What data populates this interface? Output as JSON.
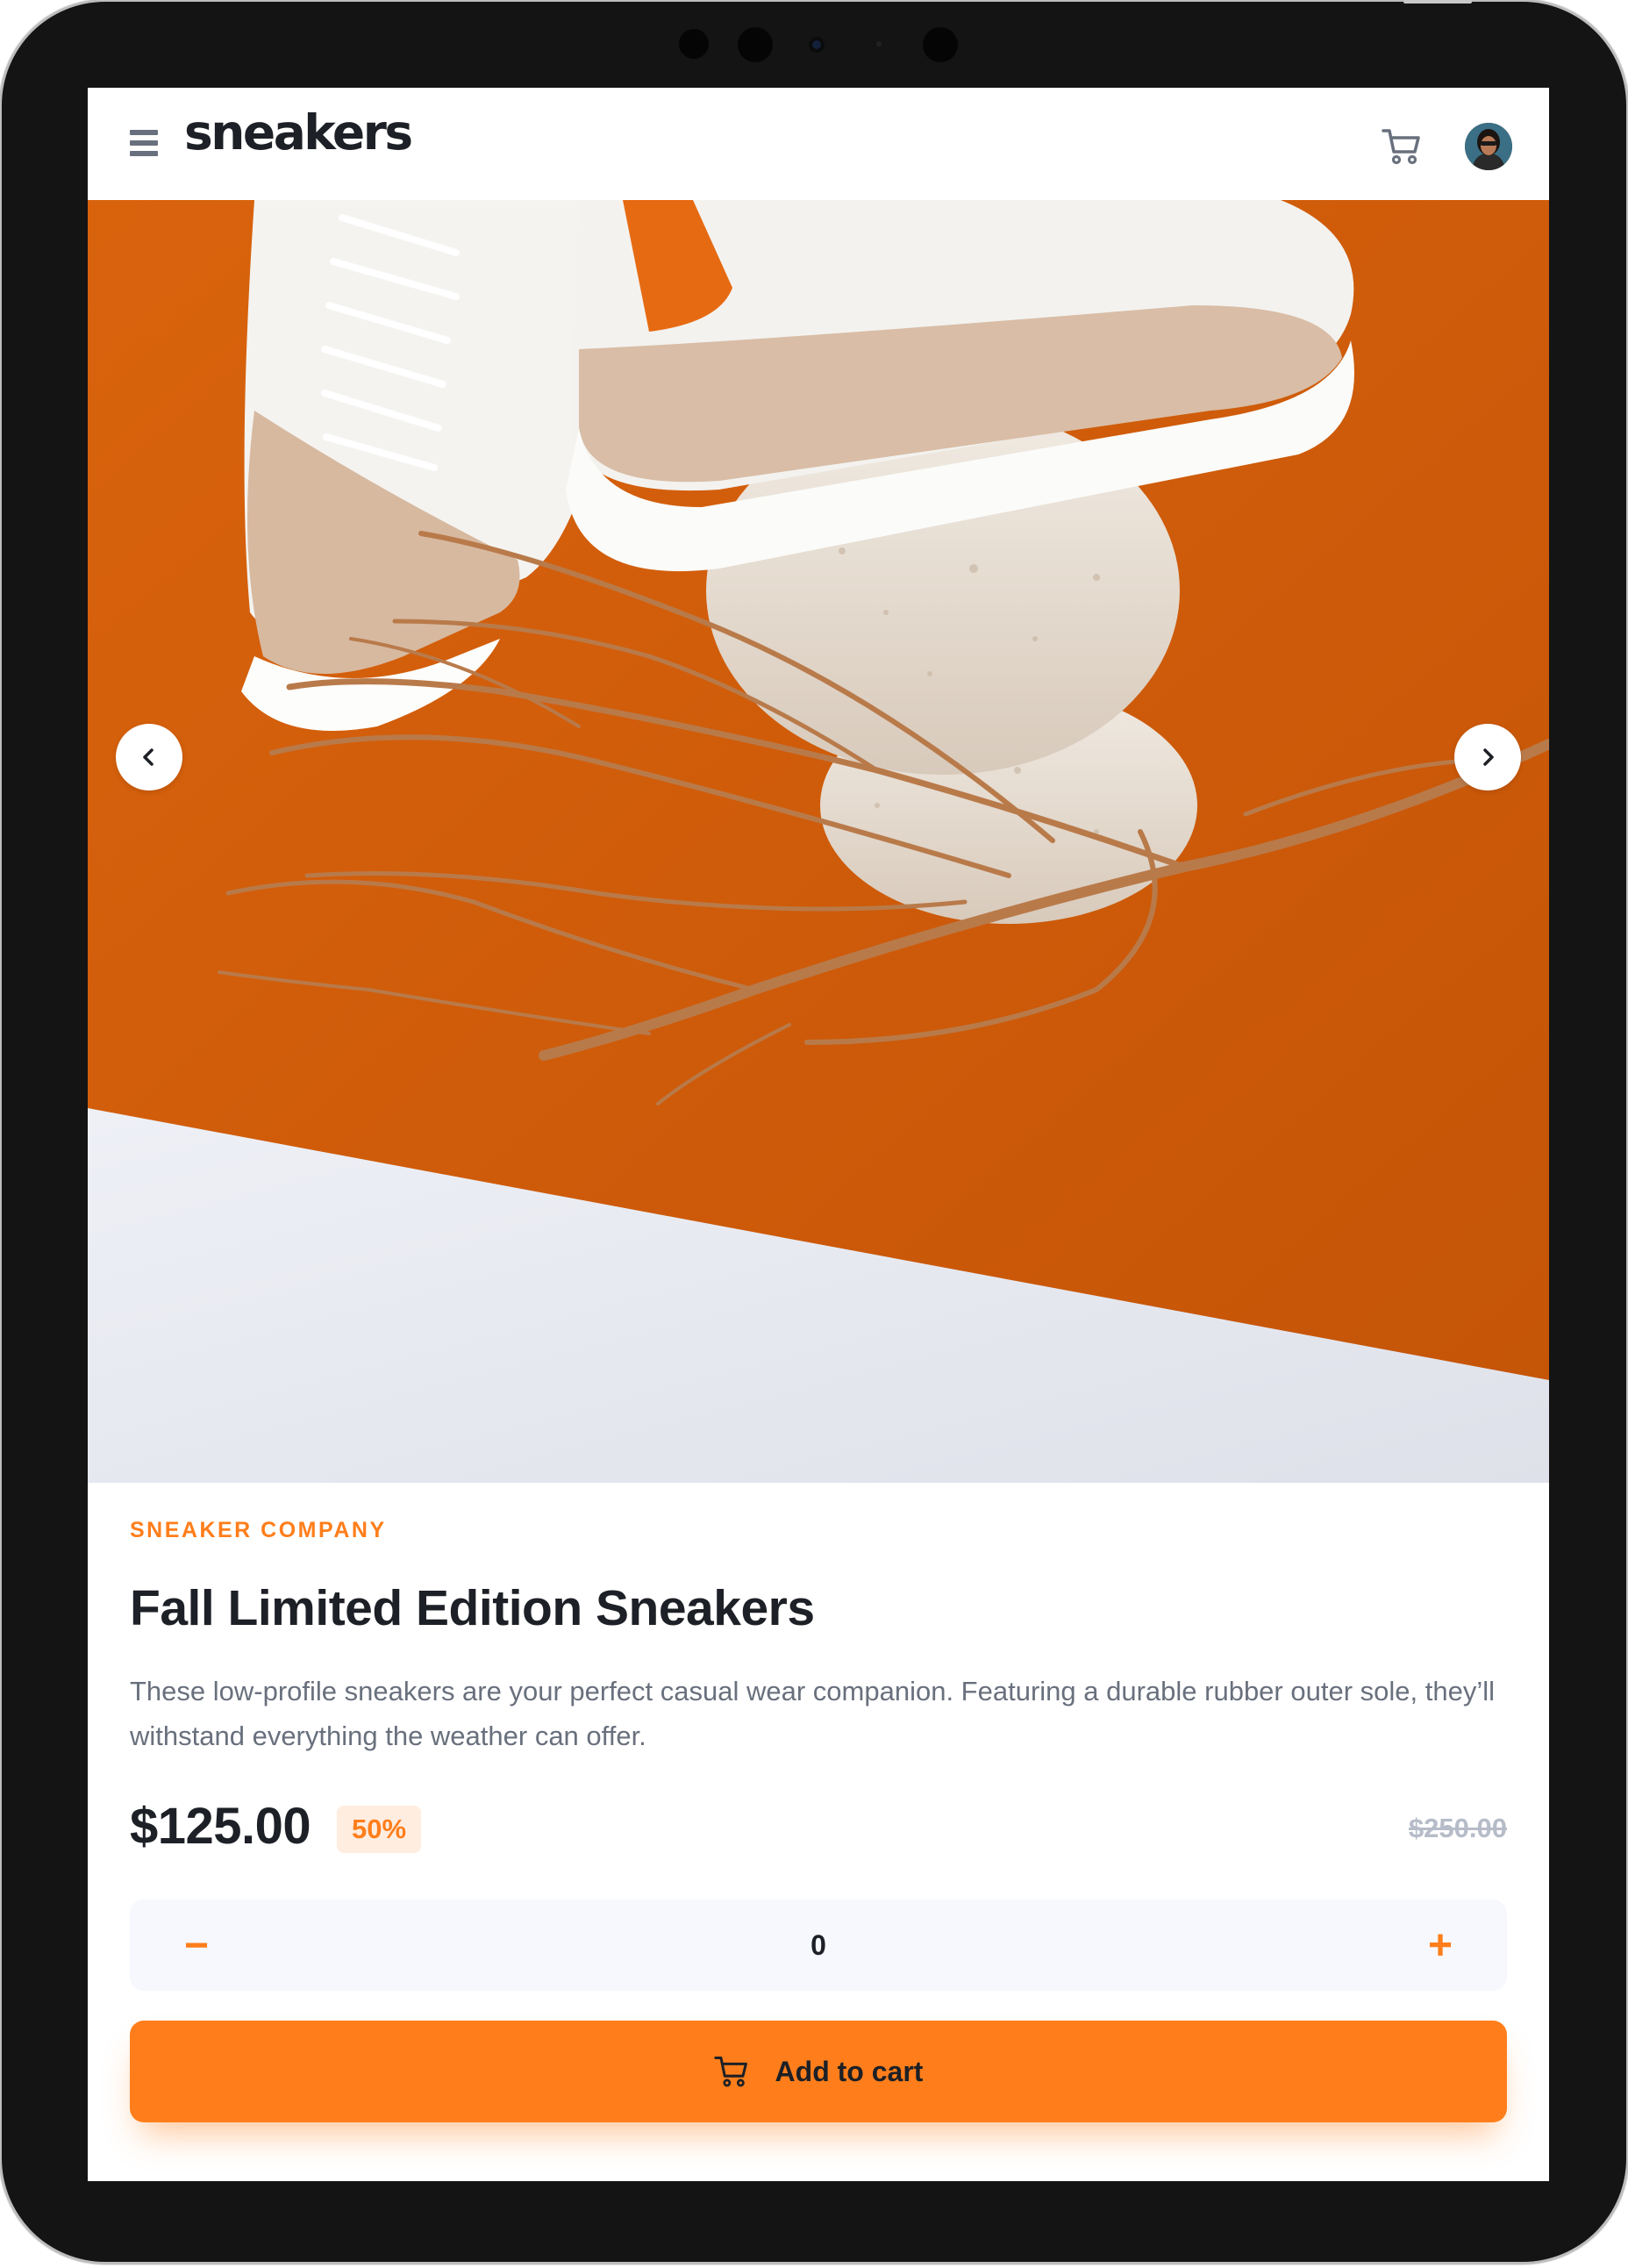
{
  "header": {
    "logo": "sneakers",
    "menu_icon": "hamburger-menu-icon",
    "cart_icon": "cart-icon",
    "avatar_icon": "user-avatar"
  },
  "gallery": {
    "prev_icon": "chevron-left-icon",
    "next_icon": "chevron-right-icon"
  },
  "product": {
    "company": "SNEAKER COMPANY",
    "title": "Fall Limited Edition Sneakers",
    "description": "These low-profile sneakers are your perfect casual wear companion. Featuring a durable rubber outer sole, they’ll withstand everything the weather can offer.",
    "price": "$125.00",
    "discount": "50%",
    "original_price": "$250.00"
  },
  "quantity": {
    "minus_label": "−",
    "value": "0",
    "plus_label": "+"
  },
  "add_to_cart": {
    "label": "Add to cart",
    "icon": "cart-icon"
  },
  "colors": {
    "accent": "#ff7e1b",
    "accent_pale": "#ffede0",
    "text_dark": "#1d2026",
    "text_gray": "#69707d",
    "muted": "#b6bcc8",
    "qty_bg": "#f6f8fd"
  }
}
